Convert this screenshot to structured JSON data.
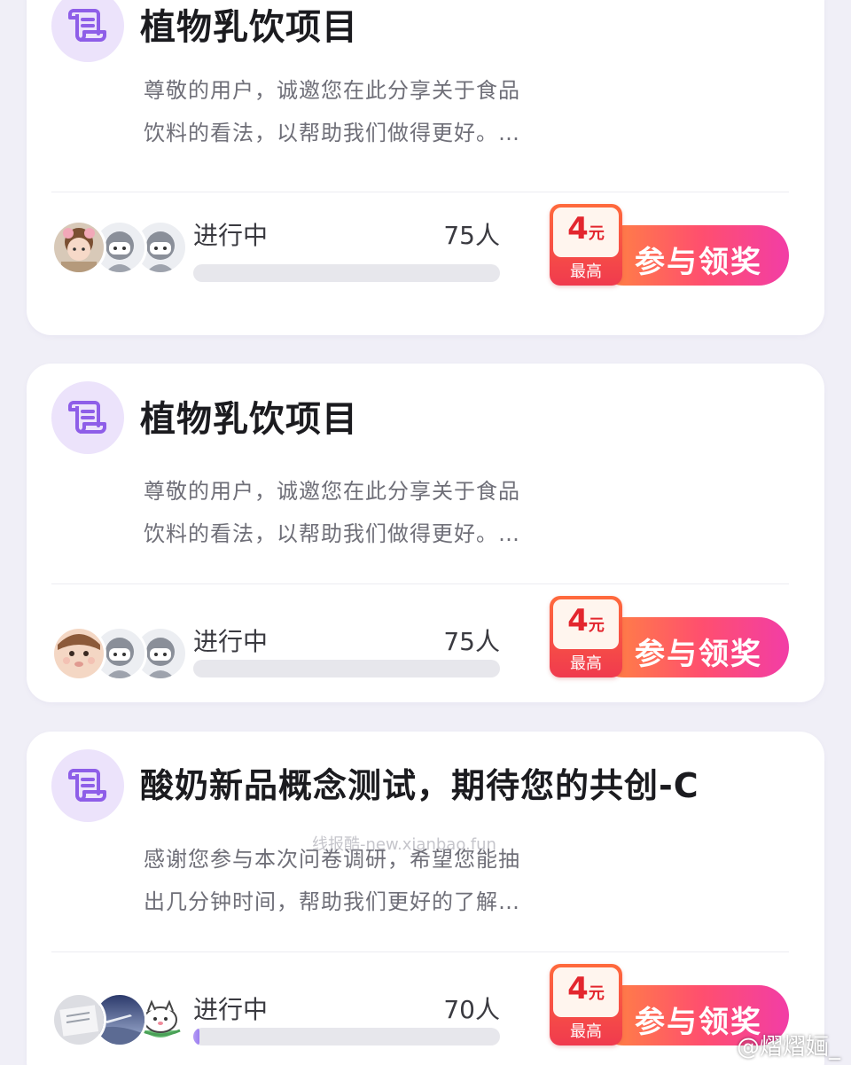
{
  "colors": {
    "page_bg": "#f0eff7",
    "card_bg": "#ffffff",
    "badge_bg": "#ece3fb",
    "badge_icon": "#8e5ee8",
    "cta_gradient_start": "#ff8a3d",
    "cta_gradient_end": "#f23da6",
    "reward_red": "#e3262e",
    "progress_track": "#e7e7ec",
    "progress_fill": "#9b7ef0"
  },
  "watermark_text": "线报酷-new.xianbao.fun",
  "weibo_handle": "@熠熠婳_",
  "surveys": [
    {
      "icon": "survey-scroll-icon",
      "title": "植物乳饮项目",
      "desc_line1": "尊敬的用户，诚邀您在此分享关于食品",
      "desc_line2": "饮料的看法，以帮助我们做得更好。…",
      "status": "进行中",
      "participants": "75人",
      "progress": 0,
      "reward_amount": "4",
      "reward_unit": "元",
      "reward_note": "最高",
      "cta_label": "参与领奖",
      "avatars": [
        "avatar-girl-doll",
        "avatar-default",
        "avatar-default"
      ]
    },
    {
      "icon": "survey-scroll-icon",
      "title": "植物乳饮项目",
      "desc_line1": "尊敬的用户，诚邀您在此分享关于食品",
      "desc_line2": "饮料的看法，以帮助我们做得更好。…",
      "status": "进行中",
      "participants": "75人",
      "progress": 0,
      "reward_amount": "4",
      "reward_unit": "元",
      "reward_note": "最高",
      "cta_label": "参与领奖",
      "avatars": [
        "avatar-baby",
        "avatar-default",
        "avatar-default"
      ]
    },
    {
      "icon": "survey-scroll-icon",
      "title": "酸奶新品概念测试，期待您的共创-C",
      "desc_line1": "感谢您参与本次问卷调研，希望您能抽",
      "desc_line2": "出几分钟时间，帮助我们更好的了解…",
      "status": "进行中",
      "participants": "70人",
      "progress": 0.02,
      "reward_amount": "4",
      "reward_unit": "元",
      "reward_note": "最高",
      "cta_label": "参与领奖",
      "avatars": [
        "avatar-photo-paper",
        "avatar-night-sky",
        "avatar-cartoon-cat"
      ]
    }
  ]
}
